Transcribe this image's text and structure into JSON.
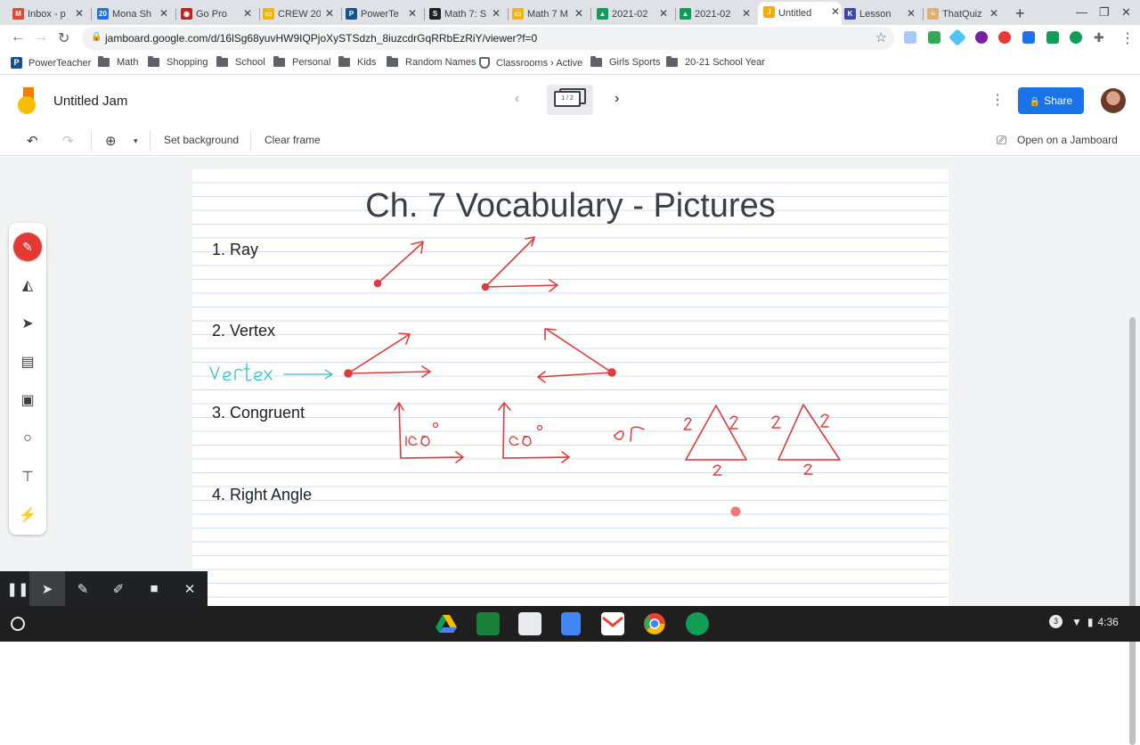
{
  "browser": {
    "tabs": [
      {
        "label": "Inbox - p",
        "color": "#ea4335",
        "glyph": "M"
      },
      {
        "label": "Mona Sh",
        "color": "#1a73e8",
        "glyph": "20"
      },
      {
        "label": "Go Pro",
        "color": "#c5221f",
        "glyph": "◉"
      },
      {
        "label": "CREW 20",
        "color": "#f4b400",
        "glyph": "▭"
      },
      {
        "label": "PowerTe",
        "color": "#1a4f8b",
        "glyph": "P"
      },
      {
        "label": "Math 7: S",
        "color": "#202124",
        "glyph": "S"
      },
      {
        "label": "Math 7 M",
        "color": "#f4b400",
        "glyph": "▭"
      },
      {
        "label": "2021-02",
        "color": "#0f9d58",
        "glyph": "▲"
      },
      {
        "label": "2021-02",
        "color": "#0f9d58",
        "glyph": "▲"
      },
      {
        "label": "Untitled",
        "color": "#f9ab00",
        "glyph": "J"
      },
      {
        "label": "Lesson",
        "color": "#3949ab",
        "glyph": "K"
      },
      {
        "label": "ThatQuiz",
        "color": "#e0b070",
        "glyph": "≡"
      }
    ],
    "active_tab_index": 9,
    "new_tab_glyph": "+",
    "url": "jamboard.google.com/d/16lSg68yuvHW9IQPjoXySTSdzh_8iuzcdrGqRRbEzRiY/viewer?f=0",
    "bookmarks": [
      {
        "label": "PowerTeacher",
        "kind": "app"
      },
      {
        "label": "Math",
        "kind": "folder"
      },
      {
        "label": "Shopping",
        "kind": "folder"
      },
      {
        "label": "School",
        "kind": "folder"
      },
      {
        "label": "Personal",
        "kind": "folder"
      },
      {
        "label": "Kids",
        "kind": "folder"
      },
      {
        "label": "Random Names",
        "kind": "folder"
      },
      {
        "label": "Classrooms › Active",
        "kind": "shield"
      },
      {
        "label": "Girls Sports",
        "kind": "folder"
      },
      {
        "label": "20-21 School Year",
        "kind": "folder"
      }
    ]
  },
  "jamboard": {
    "title": "Untitled Jam",
    "frame_indicator": "1 / 2",
    "share_label": "Share",
    "tools": {
      "set_background": "Set background",
      "clear_frame": "Clear frame",
      "open_on_jamboard": "Open on a Jamboard"
    },
    "frame": {
      "heading": "Ch. 7 Vocabulary - Pictures",
      "items": [
        "1.  Ray",
        "2.  Vertex",
        "3.  Congruent",
        "4.  Right Angle"
      ],
      "handwriting": {
        "vertex_label": "Vertex",
        "angle_label_1": "90°",
        "angle_label_2": "90°",
        "or_word": "or",
        "tri_labels": [
          "2",
          "2",
          "2",
          "2",
          "2",
          "2"
        ]
      },
      "ink_color": "#e23a3a",
      "teal_ink_color": "#33c0c0"
    }
  },
  "system": {
    "clock": "4:36",
    "notification_count": "3"
  }
}
